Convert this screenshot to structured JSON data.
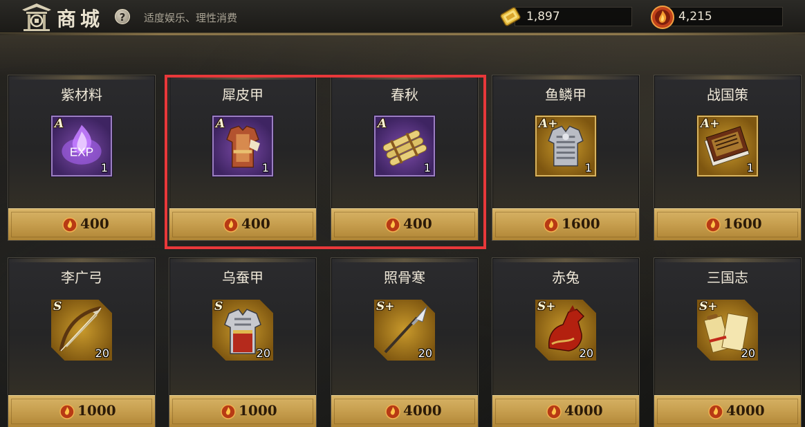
{
  "header": {
    "title": "商城",
    "help_label": "?",
    "slogan": "适度娱乐、理性消费",
    "gold_amount": "1,897",
    "coin_amount": "4,215"
  },
  "colors": {
    "accent_gold": "#c8a050",
    "highlight_border": "#e8383a",
    "purple_frame": "#7b4aa6",
    "gold_frame": "#c99a2c"
  },
  "highlighted_items": [
    "犀皮甲",
    "春秋"
  ],
  "items": [
    {
      "name": "紫材料",
      "grade": "A",
      "qty": "1",
      "price": "400",
      "frame": "purple",
      "icon": "exp-orb-icon",
      "exp_label": "EXP"
    },
    {
      "name": "犀皮甲",
      "grade": "A",
      "qty": "1",
      "price": "400",
      "frame": "purple",
      "icon": "armor-icon"
    },
    {
      "name": "春秋",
      "grade": "A",
      "qty": "1",
      "price": "400",
      "frame": "purple",
      "icon": "scroll-icon"
    },
    {
      "name": "鱼鳞甲",
      "grade": "A+",
      "qty": "1",
      "price": "1600",
      "frame": "gold",
      "icon": "scale-armor-icon"
    },
    {
      "name": "战国策",
      "grade": "A+",
      "qty": "1",
      "price": "1600",
      "frame": "gold",
      "icon": "book-icon"
    },
    {
      "name": "李广弓",
      "grade": "S",
      "qty": "20",
      "price": "1000",
      "frame": "gold-clip",
      "icon": "bow-icon"
    },
    {
      "name": "乌蚕甲",
      "grade": "S",
      "qty": "20",
      "price": "1000",
      "frame": "gold-clip",
      "icon": "silk-armor-icon"
    },
    {
      "name": "照骨寒",
      "grade": "S+",
      "qty": "20",
      "price": "4000",
      "frame": "gold-clip",
      "icon": "spear-icon"
    },
    {
      "name": "赤兔",
      "grade": "S+",
      "qty": "20",
      "price": "4000",
      "frame": "gold-clip",
      "icon": "horse-icon"
    },
    {
      "name": "三国志",
      "grade": "S+",
      "qty": "20",
      "price": "4000",
      "frame": "gold-clip",
      "icon": "scrolls-icon"
    }
  ]
}
